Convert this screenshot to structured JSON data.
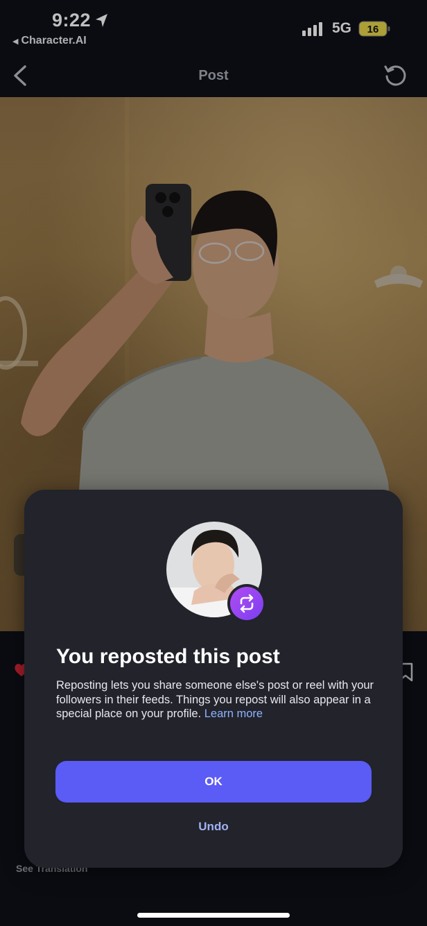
{
  "status_bar": {
    "time": "9:22",
    "back_app": "Character.AI",
    "network": "5G",
    "battery": "16"
  },
  "nav": {
    "title": "Post"
  },
  "post": {
    "see_translation": "See Translation"
  },
  "modal": {
    "title": "You reposted this post",
    "body": "Reposting lets you share someone else's post or reel with your followers in their feeds. Things you repost will also appear in a special place on your profile.",
    "learn_more": "Learn more",
    "ok_label": "OK",
    "undo_label": "Undo"
  },
  "colors": {
    "accent": "#5b5bf6",
    "link": "#8eb3ff",
    "modal_bg": "#22232b",
    "badge": "#9a45f2"
  }
}
